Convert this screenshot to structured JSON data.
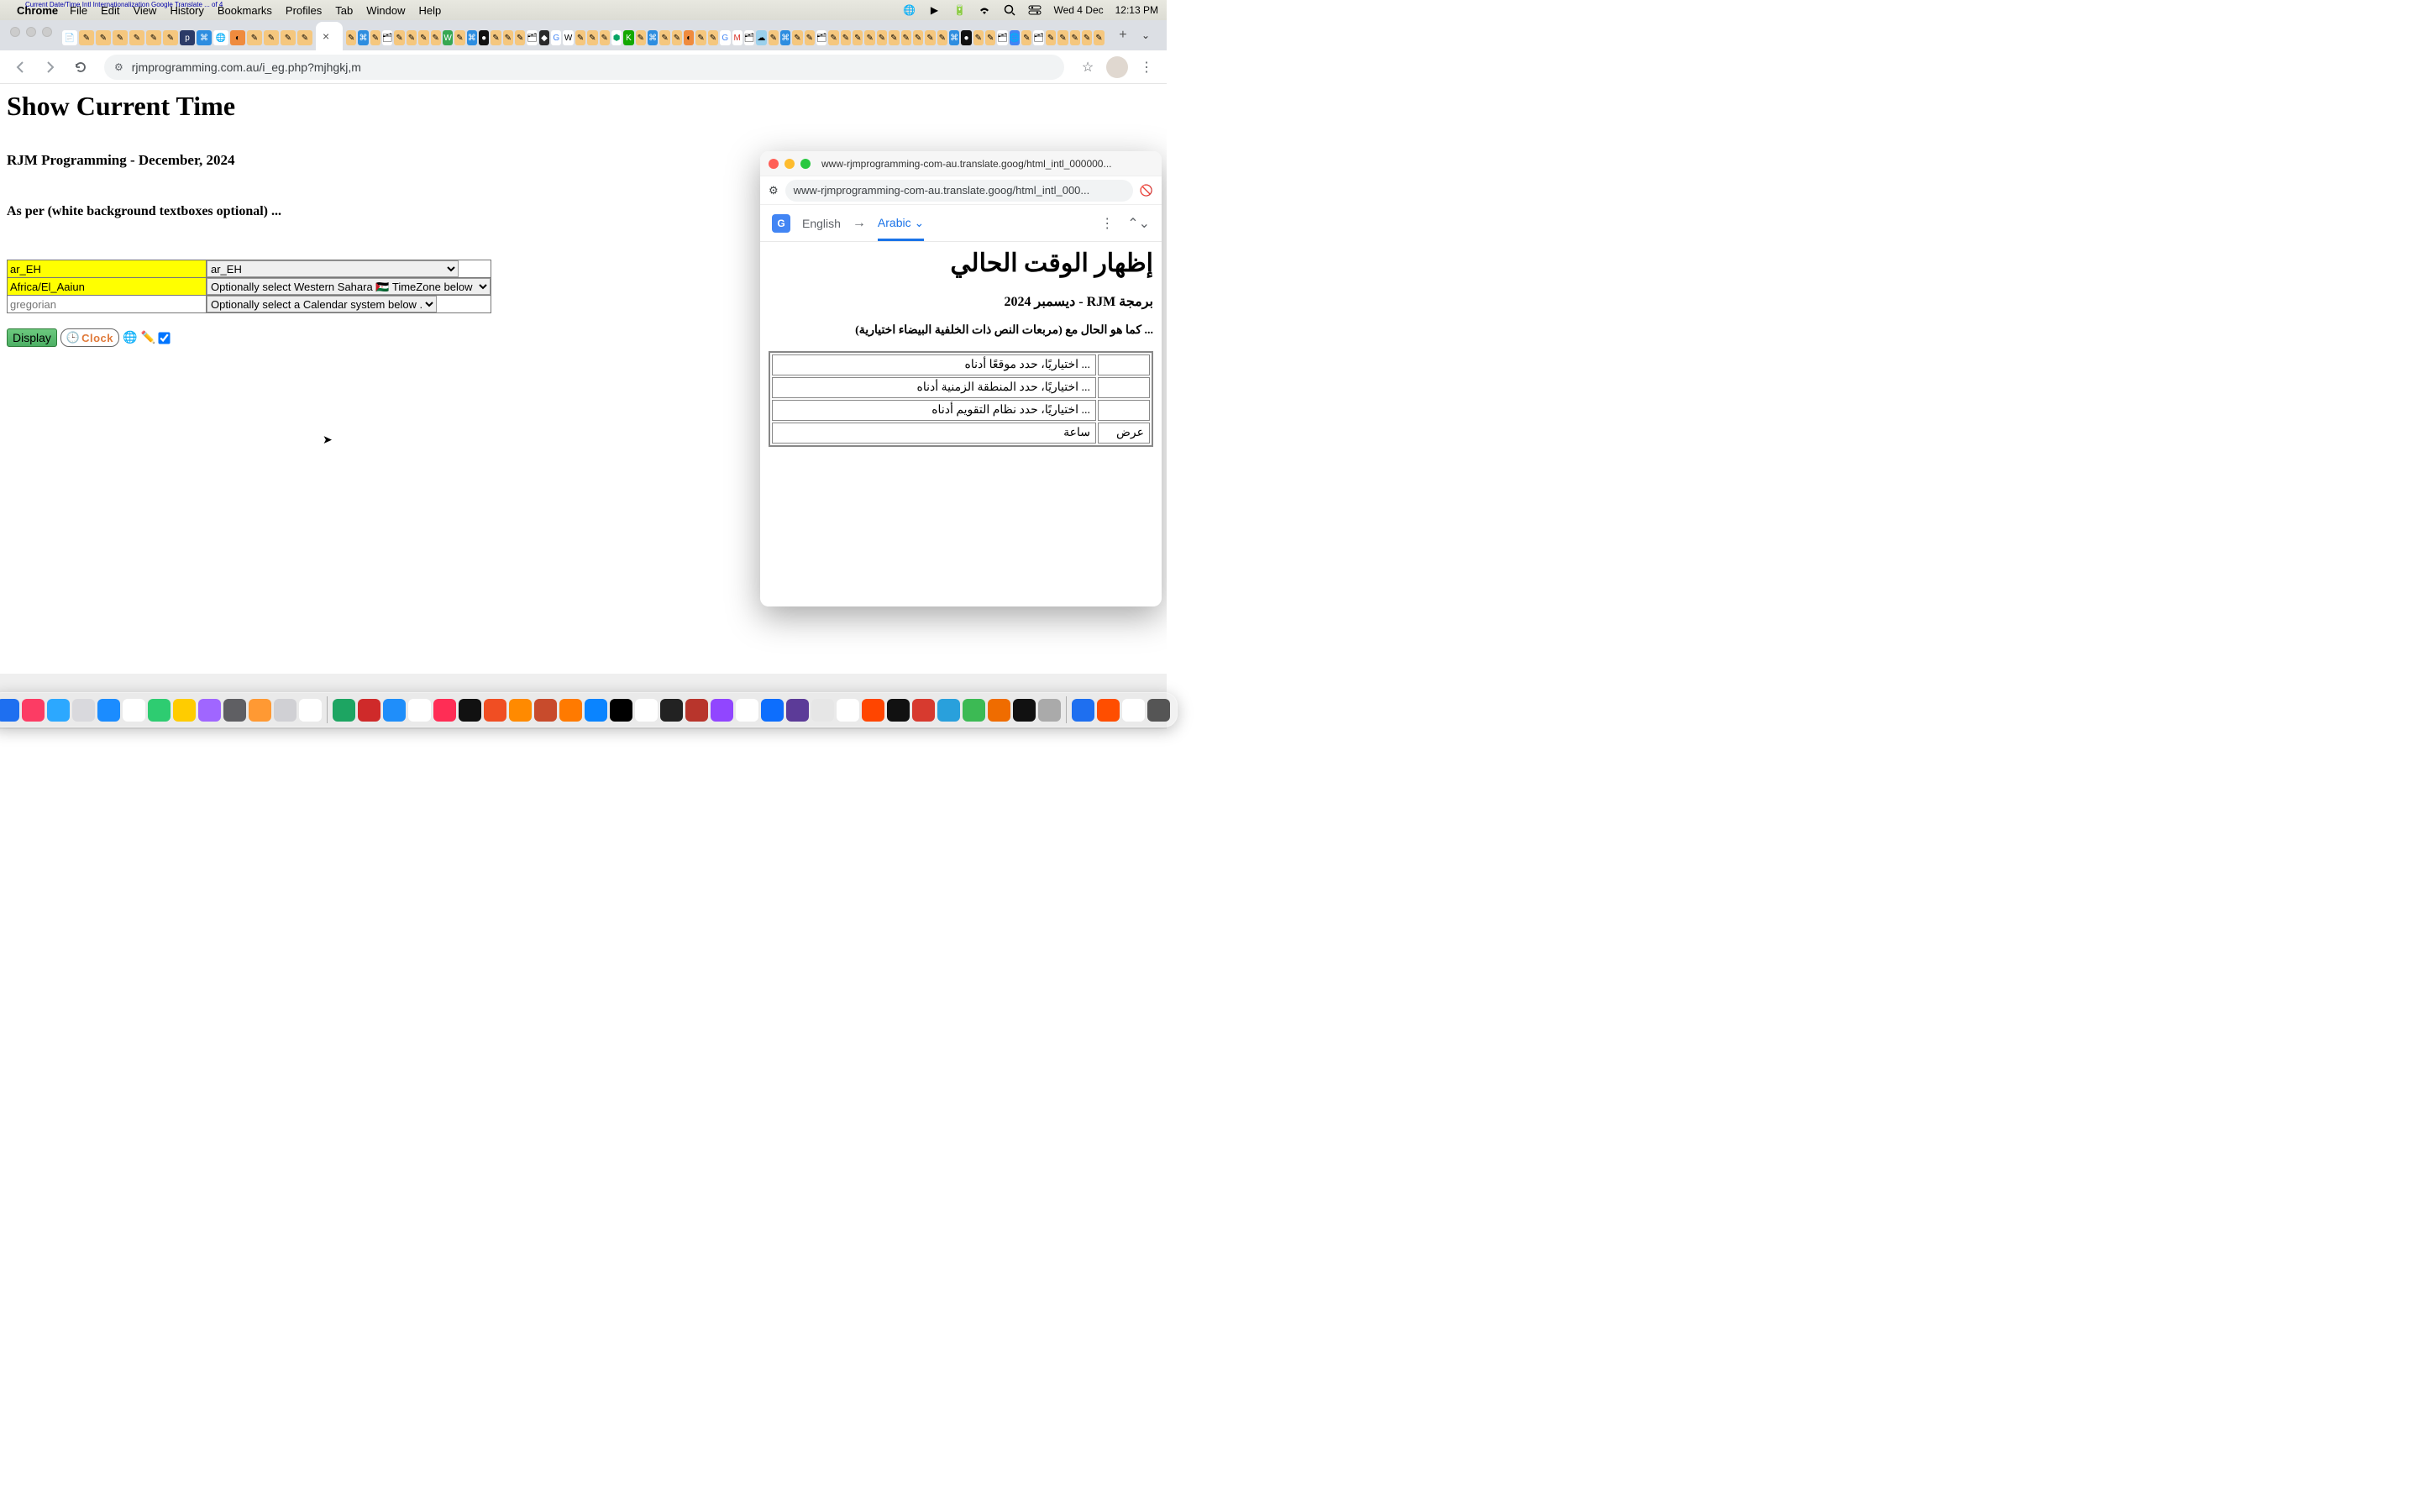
{
  "menubar": {
    "app": "Chrome",
    "items": [
      "File",
      "Edit",
      "View",
      "History",
      "Bookmarks",
      "Profiles",
      "Tab",
      "Window",
      "Help"
    ],
    "tiny_overlay": "Current Date/Time Intl Internationalization Google Translate ... of 4",
    "clock_day": "Wed 4 Dec",
    "clock_time": "12:13 PM"
  },
  "chrome": {
    "url": "rjmprogramming.com.au/i_eg.php?mjhgkj,m"
  },
  "page": {
    "h1": "Show Current Time",
    "h3a": "RJM Programming - December, 2024",
    "h3b": "As per (white background textboxes optional) ...",
    "locale_value": "ar_EH",
    "locale_select": "ar_EH",
    "tz_value": "Africa/El_Aaiun",
    "tz_select": "Optionally select Western Sahara 🇪🇭 TimeZone below ...",
    "cal_placeholder": "gregorian",
    "cal_select": "Optionally select a Calendar system below ...",
    "btn_display": "Display",
    "btn_clock": "Clock"
  },
  "popup": {
    "window_title": "www-rjmprogramming-com-au.translate.goog/html_intl_000000...",
    "url": "www-rjmprogramming-com-au.translate.goog/html_intl_000...",
    "lang_from": "English",
    "lang_to": "Arabic",
    "h1": "إظهار الوقت الحالي",
    "h3": "برمجة RJM - ديسمبر 2024",
    "h4": "... كما هو الحال مع (مربعات النص ذات الخلفية البيضاء اختيارية)",
    "row1": "... اختياريًا، حدد موقعًا أدناه",
    "row2": "... اختياريًا، حدد المنطقة الزمنية أدناه",
    "row3": "... اختياريًا، حدد نظام التقويم أدناه",
    "row4a": "عرض",
    "row4b": "ساعة"
  },
  "dock_colors": [
    "#1e6ff0",
    "#fc3c64",
    "#2ca8ff",
    "#d9d9dd",
    "#1b8cff",
    "#ffffff",
    "#2ecc71",
    "#ffcc00",
    "#a066ff",
    "#5f5f63",
    "#ff9933",
    "#d0d0d4",
    "#ffffff",
    "#1da562",
    "#cf2a2a",
    "#1f8efa",
    "#ffffff",
    "#ff2d55",
    "#111111",
    "#f04e23",
    "#ff8a00",
    "#c84b2c",
    "#ff7a00",
    "#0a84ff",
    "#000000",
    "#ffffff",
    "#222222",
    "#b8352c",
    "#9146ff",
    "#ffffff",
    "#0d6efd",
    "#5c3b98",
    "#e6e6e6",
    "#ffffff",
    "#ff4500",
    "#111111",
    "#d73a2f",
    "#29a0dc",
    "#3cba54",
    "#ef6c00",
    "#111111",
    "#aaaaaa",
    "#1e6ff0",
    "#ff4e00",
    "#ffffff",
    "#555555"
  ]
}
